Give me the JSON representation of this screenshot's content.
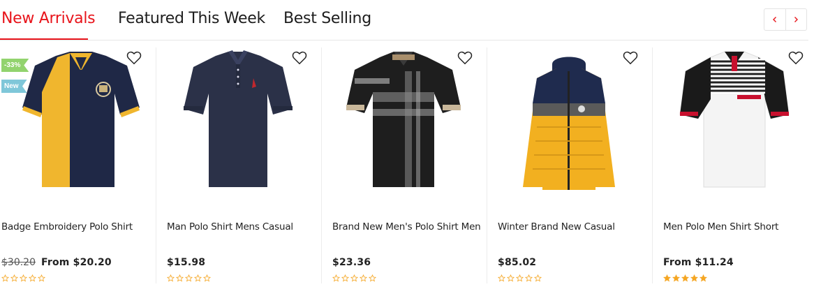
{
  "tabs": [
    {
      "label": "New Arrivals",
      "active": true
    },
    {
      "label": "Featured This Week",
      "active": false
    },
    {
      "label": "Best Selling",
      "active": false
    }
  ],
  "nav": {
    "prev_icon": "chevron-left-icon",
    "next_icon": "chevron-right-icon"
  },
  "colors": {
    "accent": "#e8141b",
    "star": "#f5a623",
    "sale_badge": "#92d36e",
    "new_badge": "#7fc7d9"
  },
  "products": [
    {
      "title": "Badge Embroidery Polo Shirt",
      "old_price": "$30.20",
      "price": "From $20.20",
      "badges": [
        "-33%",
        "New"
      ],
      "rating": 0,
      "image": "navy-yellow-polo-shirt"
    },
    {
      "title": "Man Polo Shirt Mens Casual",
      "old_price": "",
      "price": "$15.98",
      "badges": [],
      "rating": 0,
      "image": "navy-polo-shirt"
    },
    {
      "title": "Brand New Men's Polo Shirt Men",
      "old_price": "",
      "price": "$23.36",
      "badges": [],
      "rating": 0,
      "image": "black-plaid-polo-shirt"
    },
    {
      "title": "Winter Brand New Casual",
      "old_price": "",
      "price": "$85.02",
      "badges": [],
      "rating": 0,
      "image": "yellow-navy-puffer-jacket"
    },
    {
      "title": "Men Polo Men Shirt Short",
      "old_price": "",
      "price": "From $11.24",
      "badges": [],
      "rating": 5,
      "image": "white-striped-polo-shirt"
    }
  ]
}
